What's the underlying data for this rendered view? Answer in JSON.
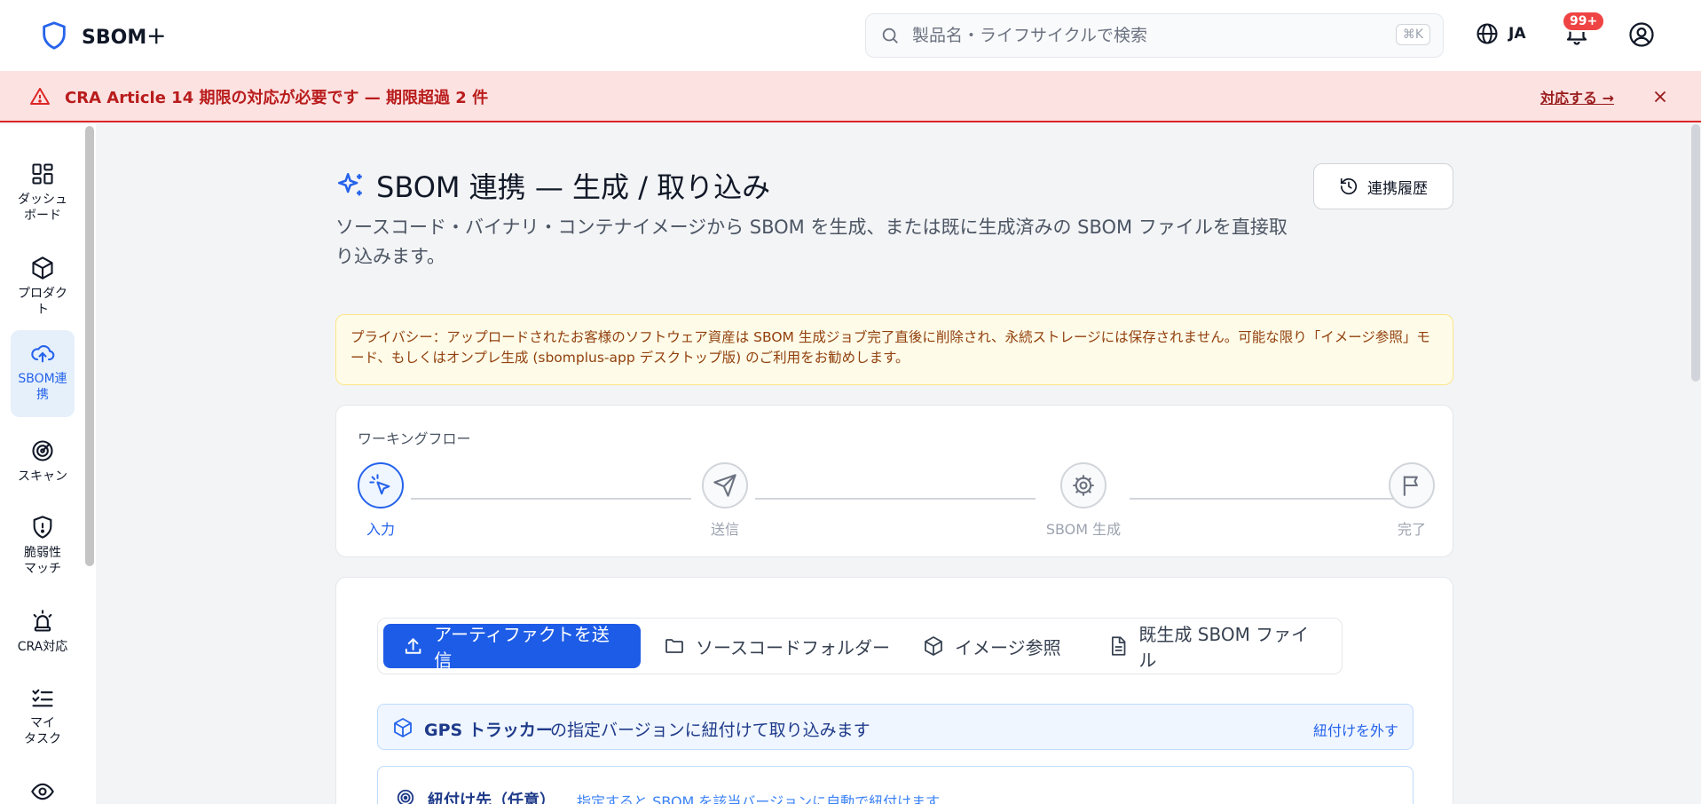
{
  "header": {
    "app_name": "SBOM＋",
    "search_placeholder": "製品名・ライフサイクルで検索",
    "search_shortcut": "⌘K",
    "language": "JA",
    "notification_count": "99+"
  },
  "alert": {
    "message": "CRA Article 14 期限の対応が必要です — 期限超過 2 件",
    "action": "対応する →"
  },
  "sidebar": {
    "items": [
      {
        "label": "ダッシュ\nボード",
        "icon": "dashboard-icon"
      },
      {
        "label": "プロダク\nト",
        "icon": "package-icon"
      },
      {
        "label": "SBOM連\n携",
        "icon": "cloud-upload-icon"
      },
      {
        "label": "スキャン",
        "icon": "radar-icon"
      },
      {
        "label": "脆弱性\nマッチ",
        "icon": "shield-alert-icon"
      },
      {
        "label": "CRA対応",
        "icon": "siren-icon"
      },
      {
        "label": "マイ\nタスク",
        "icon": "list-check-icon"
      },
      {
        "label": "",
        "icon": "eye-icon"
      }
    ]
  },
  "main": {
    "title": "SBOM 連携 — 生成 / 取り込み",
    "subtitle": "ソースコード・バイナリ・コンテナイメージから SBOM を生成、または既に生成済みの SBOM ファイルを直接取り込みます。",
    "history_button": "連携履歴",
    "privacy_notice": "プライバシー：アップロードされたお客様のソフトウェア資産は SBOM 生成ジョブ完了直後に削除され、永続ストレージには保存されません。可能な限り「イメージ参照」モード、もしくはオンプレ生成 (sbomplus-app デスクトップ版) のご利用をお勧めします。"
  },
  "workflow": {
    "label": "ワーキングフロー",
    "steps": [
      "入力",
      "送信",
      "SBOM 生成",
      "完了"
    ]
  },
  "tabs": [
    "アーティファクトを送信",
    "ソースコードフォルダー",
    "イメージ参照",
    "既生成 SBOM ファイル"
  ],
  "binding": {
    "product": "GPS トラッカー",
    "text": "の指定バージョンに紐付けて取り込みます",
    "unlink": "紐付けを外す"
  },
  "target": {
    "title": "紐付け先（任意）",
    "hint": "指定すると SBOM を該当バージョンに自動で紐付けます"
  },
  "colors": {
    "primary": "#1d5ce6",
    "alert_bg": "#fde2e2",
    "alert_text": "#b91c1c",
    "notice_bg": "#fefce8"
  }
}
